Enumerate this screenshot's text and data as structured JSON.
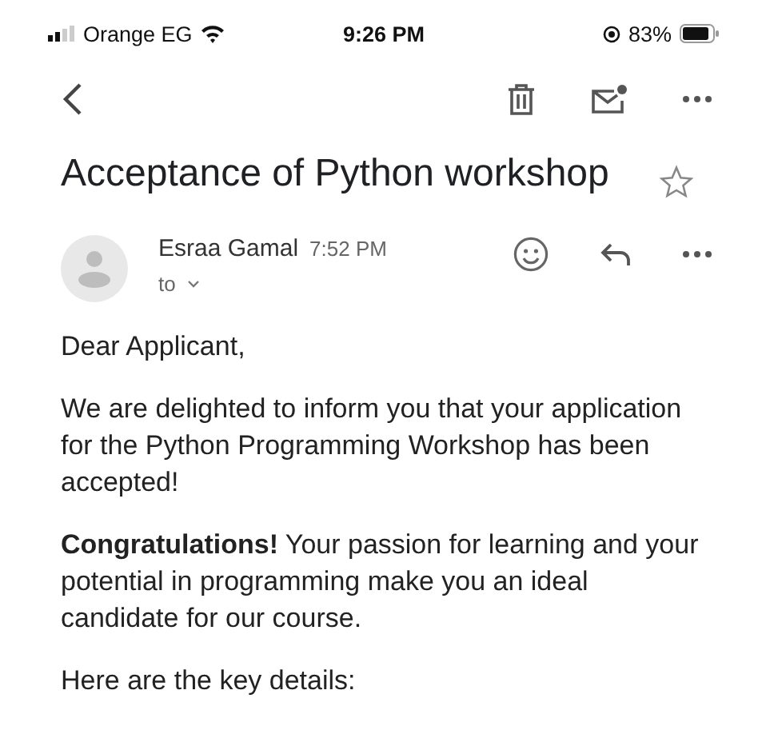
{
  "status_bar": {
    "carrier": "Orange EG",
    "time": "9:26 PM",
    "battery": "83%"
  },
  "subject": {
    "title": "Acceptance of Python workshop",
    "starred": false
  },
  "sender": {
    "name": "Esraa Gamal",
    "time": "7:52 PM",
    "recipient_label": "to"
  },
  "body": [
    "Dear Applicant,",
    "We are delighted to inform you that your application for the Python Programming Workshop has been accepted!",
    "**Congratulations!** Your passion for learning and your potential in programming make you an ideal candidate for our course.",
    "Here are the key details:"
  ]
}
